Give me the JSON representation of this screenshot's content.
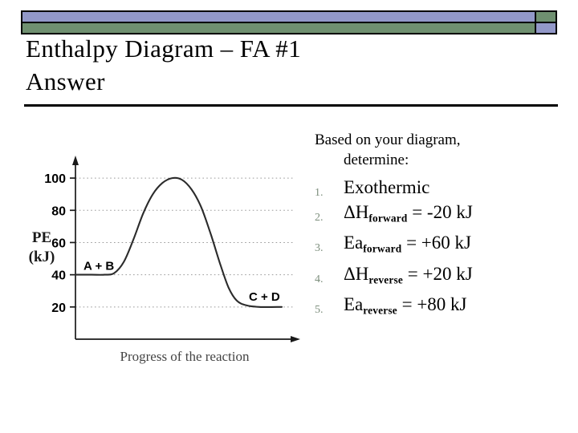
{
  "slide": {
    "title": "Enthalpy Diagram – FA #1\nAnswer",
    "decoration": {
      "purple": "#9298c8",
      "green": "#6f9070",
      "outline": "#000000"
    },
    "rule_color": "#000000"
  },
  "answers_panel": {
    "prompt_line1": "Based on your diagram,",
    "prompt_line2": "determine:",
    "marker_color": "#7d8f7d",
    "items": [
      {
        "num": "1.",
        "main": "Exothermic",
        "sub": "",
        "tail": ""
      },
      {
        "num": "2.",
        "main": "ΔH",
        "sub": "forward",
        "tail": " = -20 kJ"
      },
      {
        "num": "3.",
        "main": "Ea",
        "sub": "forward",
        "tail": " = +60 kJ"
      },
      {
        "num": "4.",
        "main": "ΔH",
        "sub": "reverse",
        "tail": " = +20 kJ"
      },
      {
        "num": "5.",
        "main": "Ea",
        "sub": "reverse",
        "tail": " = +80 kJ"
      }
    ]
  },
  "chart_data": {
    "type": "line",
    "title": "",
    "xlabel": "Progress of the reaction",
    "ylabel": "PE (kJ)",
    "ylabel_line1": "PE",
    "ylabel_line2": "(kJ)",
    "yticks": [
      20,
      40,
      60,
      80,
      100
    ],
    "ytick_labels": [
      "20",
      "40",
      "60",
      "80",
      "100"
    ],
    "ylim": [
      0,
      110
    ],
    "xticks": [],
    "xtick_labels": [],
    "grid": "horizontal-dotted",
    "legend": "none",
    "curve_color": "#2b2b2b",
    "annotations": [
      {
        "text": "A + B",
        "value": 40,
        "position": "reactants-plateau"
      },
      {
        "text": "C + D",
        "value": 20,
        "position": "products-plateau"
      }
    ],
    "series": [
      {
        "name": "Potential energy",
        "description": "Reaction coordinate profile: reactants at 40 kJ, activated complex peak at 100 kJ, products at 20 kJ",
        "reactant_energy": 40,
        "peak_energy": 100,
        "product_energy": 20,
        "activation_energy_forward": 60,
        "activation_energy_reverse": 80,
        "delta_h": -20,
        "points": [
          [
            0,
            40
          ],
          [
            10,
            40
          ],
          [
            18,
            40
          ],
          [
            24,
            41
          ],
          [
            30,
            48
          ],
          [
            36,
            62
          ],
          [
            42,
            78
          ],
          [
            48,
            90
          ],
          [
            54,
            97
          ],
          [
            60,
            100
          ],
          [
            66,
            99
          ],
          [
            72,
            93
          ],
          [
            78,
            82
          ],
          [
            84,
            65
          ],
          [
            90,
            46
          ],
          [
            95,
            32
          ],
          [
            100,
            24
          ],
          [
            106,
            21
          ],
          [
            114,
            20
          ],
          [
            128,
            20
          ]
        ]
      }
    ]
  }
}
